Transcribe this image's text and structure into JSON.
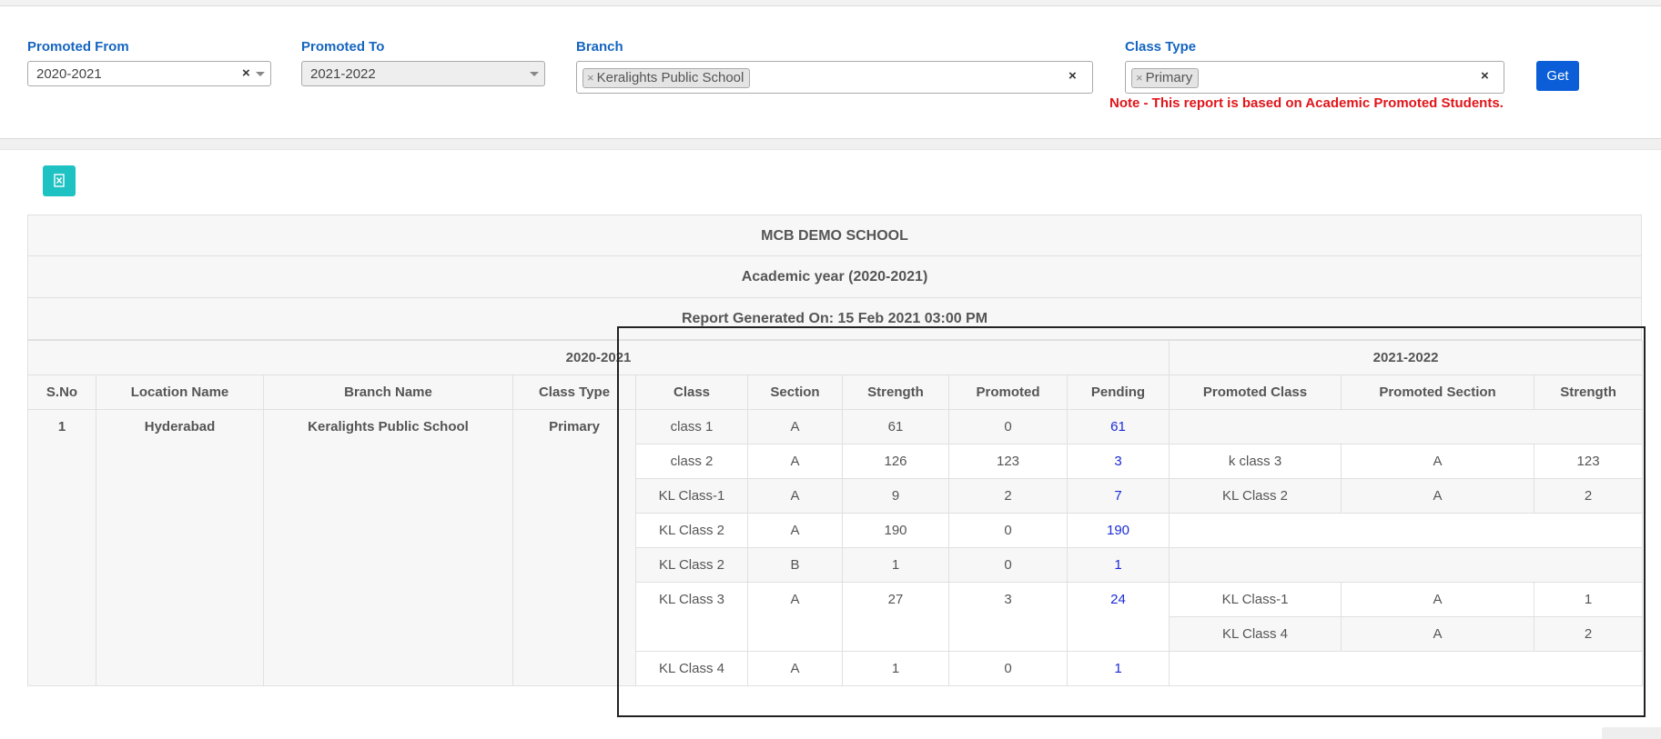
{
  "filters": {
    "promoted_from": {
      "label": "Promoted From",
      "value": "2020-2021"
    },
    "promoted_to": {
      "label": "Promoted To",
      "value": "2021-2022"
    },
    "branch": {
      "label": "Branch",
      "tag": "Keralights Public School"
    },
    "class_type": {
      "label": "Class Type",
      "tag": "Primary"
    },
    "get_label": "Get",
    "note": "Note - This report is based on Academic Promoted Students."
  },
  "report": {
    "school": "MCB DEMO SCHOOL",
    "academic_year": "Academic year (2020-2021)",
    "generated": "Report Generated On: 15 Feb 2021 03:00 PM",
    "group_from": "2020-2021",
    "group_to": "2021-2022",
    "columns": [
      "S.No",
      "Location Name",
      "Branch Name",
      "Class Type",
      "Class",
      "Section",
      "Strength",
      "Promoted",
      "Pending",
      "Promoted Class",
      "Promoted Section",
      "Strength"
    ],
    "sno": "1",
    "location": "Hyderabad",
    "branch": "Keralights Public School",
    "class_type": "Primary",
    "rows": [
      {
        "class": "class 1",
        "section": "A",
        "strength": "61",
        "promoted": "0",
        "pending": "61"
      },
      {
        "class": "class 2",
        "section": "A",
        "strength": "126",
        "promoted": "123",
        "pending": "3"
      },
      {
        "class": "KL Class-1",
        "section": "A",
        "strength": "9",
        "promoted": "2",
        "pending": "7"
      },
      {
        "class": "KL Class 2",
        "section": "A",
        "strength": "190",
        "promoted": "0",
        "pending": "190"
      },
      {
        "class": "KL Class 2",
        "section": "B",
        "strength": "1",
        "promoted": "0",
        "pending": "1"
      },
      {
        "class": "KL Class 3",
        "section": "A",
        "strength": "27",
        "promoted": "3",
        "pending": "24"
      },
      {
        "class": "KL Class 4",
        "section": "A",
        "strength": "1",
        "promoted": "0",
        "pending": "1"
      }
    ],
    "promotions": [
      {
        "p_class": "k class 3",
        "p_section": "A",
        "p_strength": "123"
      },
      {
        "p_class": "KL Class 2",
        "p_section": "A",
        "p_strength": "2"
      },
      {
        "p_class": "KL Class-1",
        "p_section": "A",
        "p_strength": "1"
      },
      {
        "p_class": "KL Class 4",
        "p_section": "A",
        "p_strength": "2"
      }
    ]
  },
  "colors": {
    "accent": "#1565c0",
    "button": "#0b5ed7",
    "excel": "#1fc2c2",
    "note": "#e0151b",
    "pending": "#1b2bd6"
  },
  "icons": {
    "excel": "excel-export-icon"
  }
}
